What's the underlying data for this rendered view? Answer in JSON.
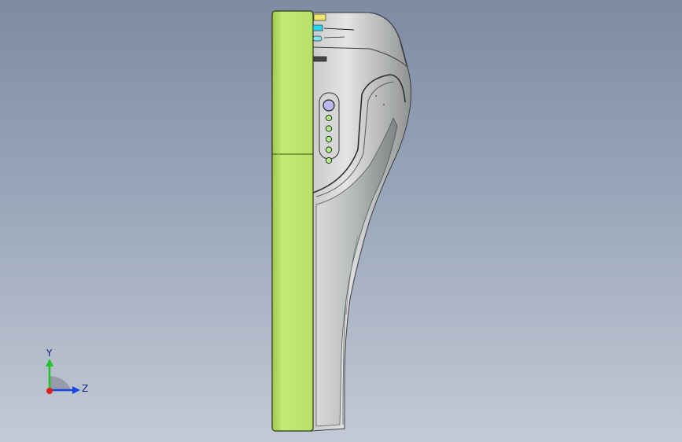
{
  "viewport": {
    "background_top": "#7d8ba3",
    "background_bottom": "#c3cad6",
    "model_colors": {
      "front_panel": "#c0ea72",
      "body_shell": "#d2d4d4",
      "indicator_led": "#b8ef8c",
      "power_button": "#b9b9f0",
      "connector_yellow": "#f0e56a",
      "connector_cyan": "#27d8f0"
    },
    "led_count": 5
  },
  "triad": {
    "y_label": "Y",
    "z_label": "Z",
    "y_color": "#22c02a",
    "z_color": "#1845e0",
    "x_color": "#e02020"
  }
}
